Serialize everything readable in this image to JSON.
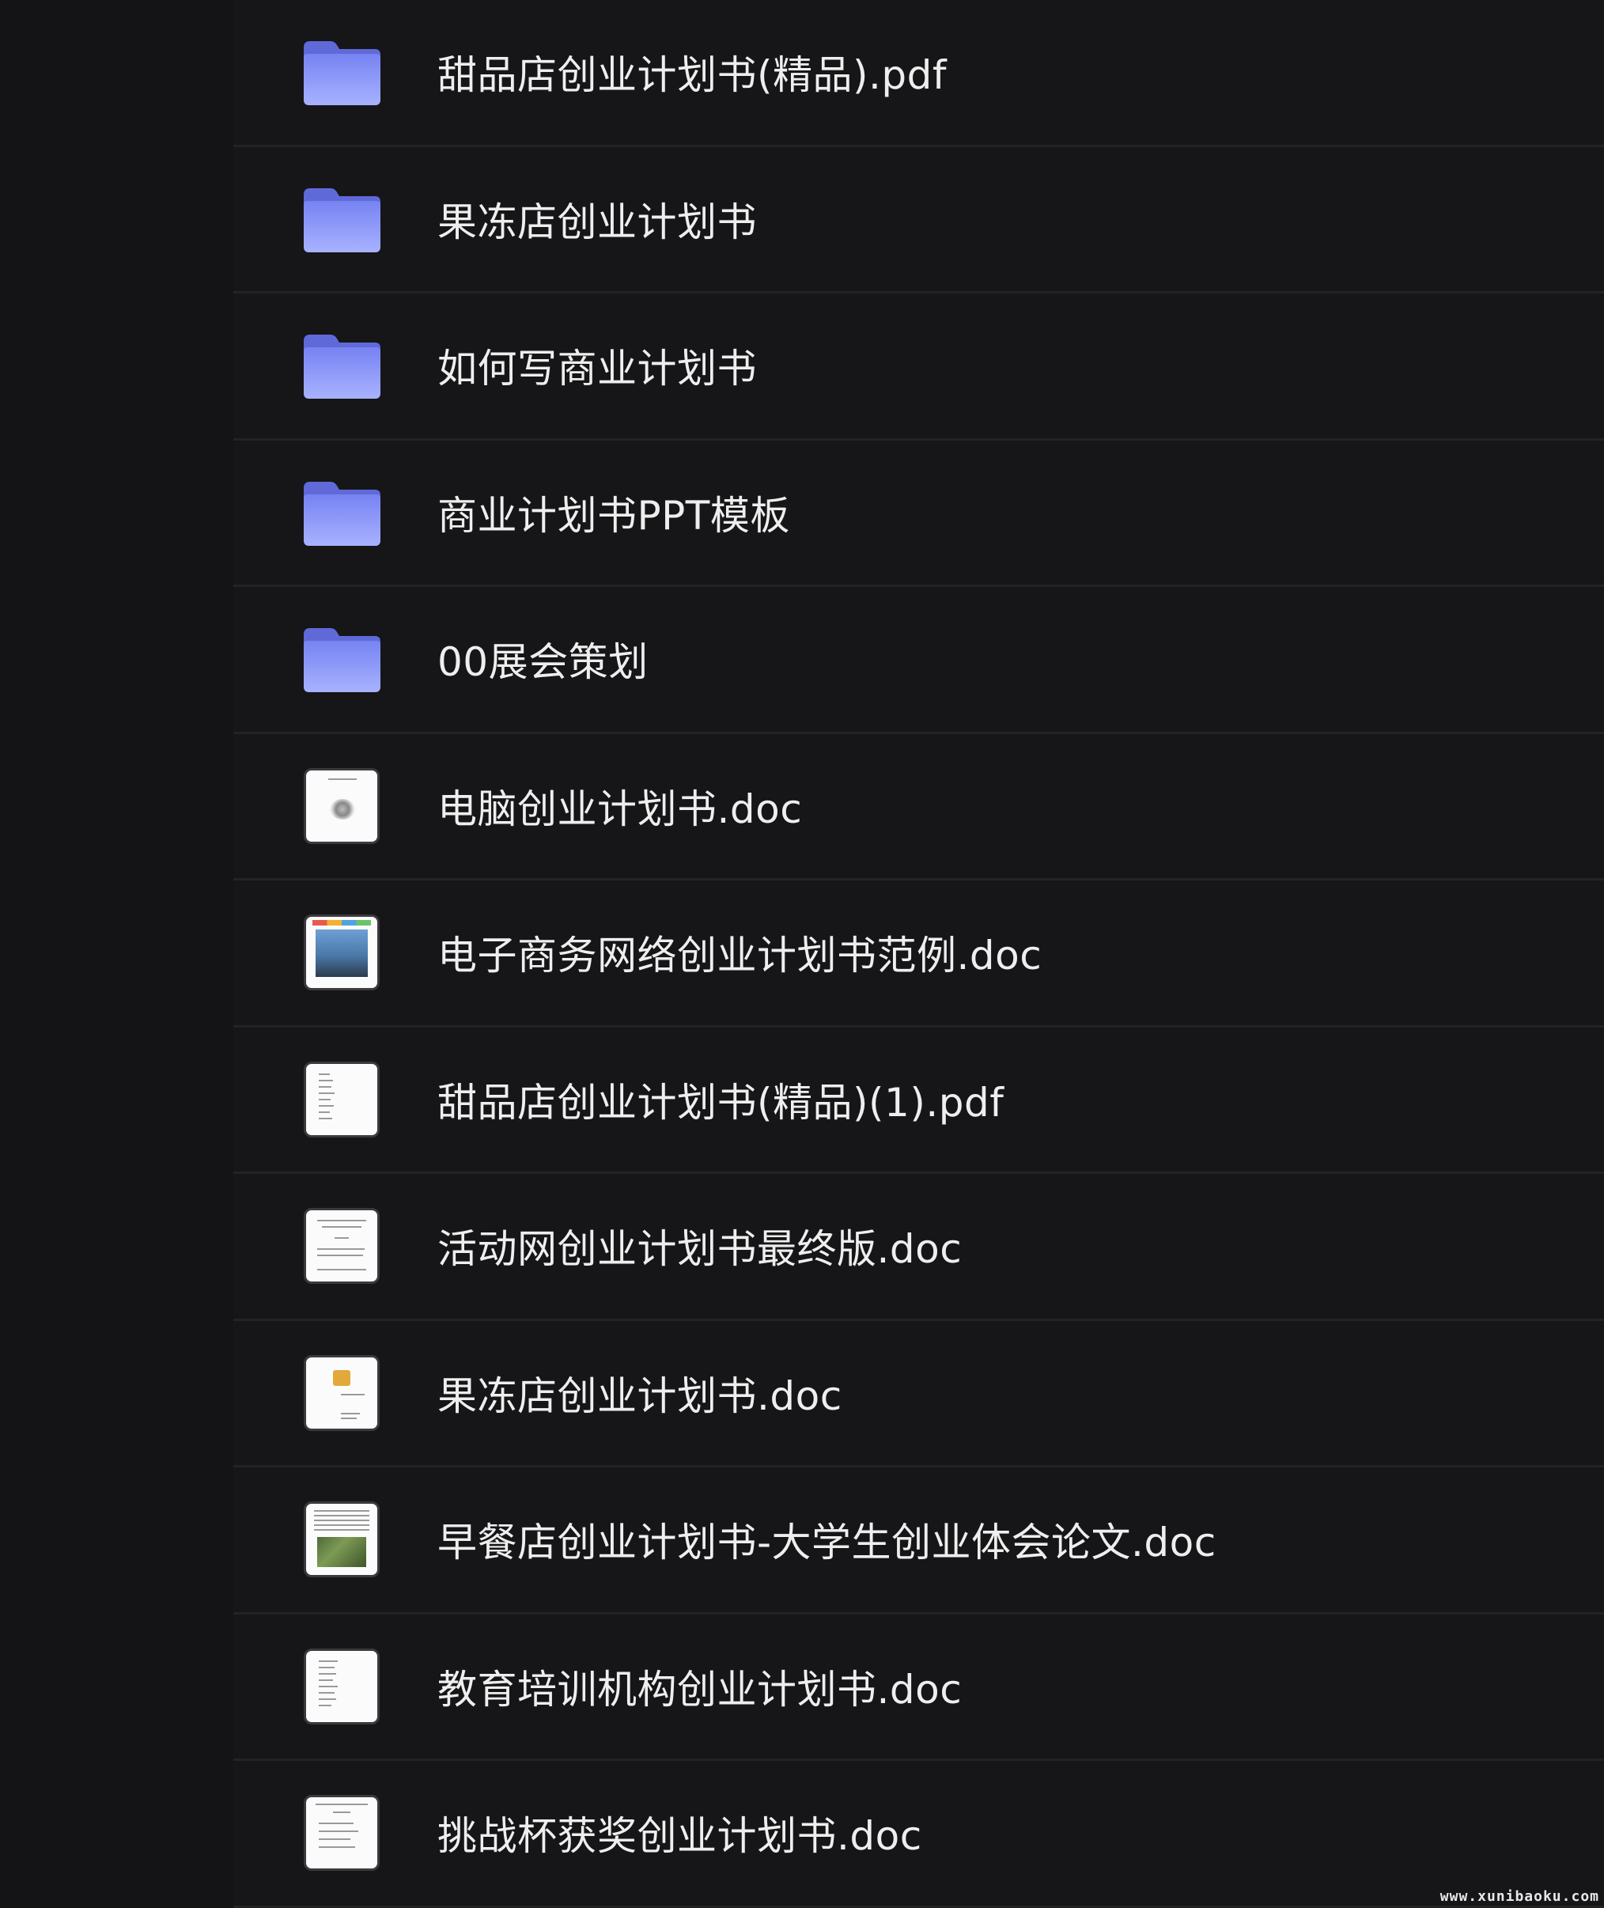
{
  "files": [
    {
      "name": "甜品店创业计划书(精品).pdf",
      "type": "folder",
      "icon": "folder-icon"
    },
    {
      "name": "果冻店创业计划书",
      "type": "folder",
      "icon": "folder-icon"
    },
    {
      "name": "如何写商业计划书",
      "type": "folder",
      "icon": "folder-icon"
    },
    {
      "name": "商业计划书PPT模板",
      "type": "folder",
      "icon": "folder-icon"
    },
    {
      "name": "00展会策划",
      "type": "folder",
      "icon": "folder-icon"
    },
    {
      "name": "电脑创业计划书.doc",
      "type": "document",
      "icon": "document-thumbnail-icon"
    },
    {
      "name": "电子商务网络创业计划书范例.doc",
      "type": "document",
      "icon": "document-thumbnail-icon"
    },
    {
      "name": "甜品店创业计划书(精品)(1).pdf",
      "type": "document",
      "icon": "document-thumbnail-icon"
    },
    {
      "name": "活动网创业计划书最终版.doc",
      "type": "document",
      "icon": "document-thumbnail-icon"
    },
    {
      "name": "果冻店创业计划书.doc",
      "type": "document",
      "icon": "document-thumbnail-icon"
    },
    {
      "name": "早餐店创业计划书-大学生创业体会论文.doc",
      "type": "document",
      "icon": "document-thumbnail-icon"
    },
    {
      "name": "教育培训机构创业计划书.doc",
      "type": "document",
      "icon": "document-thumbnail-icon"
    },
    {
      "name": "挑战杯获奖创业计划书.doc",
      "type": "document",
      "icon": "document-thumbnail-icon"
    }
  ],
  "watermark": "www.xunibaoku.com",
  "colors": {
    "background": "#161618",
    "folder_top": "#6f7cf0",
    "folder_bottom": "#a9b4ff",
    "text": "#eeeeee",
    "separator": "#232327"
  }
}
